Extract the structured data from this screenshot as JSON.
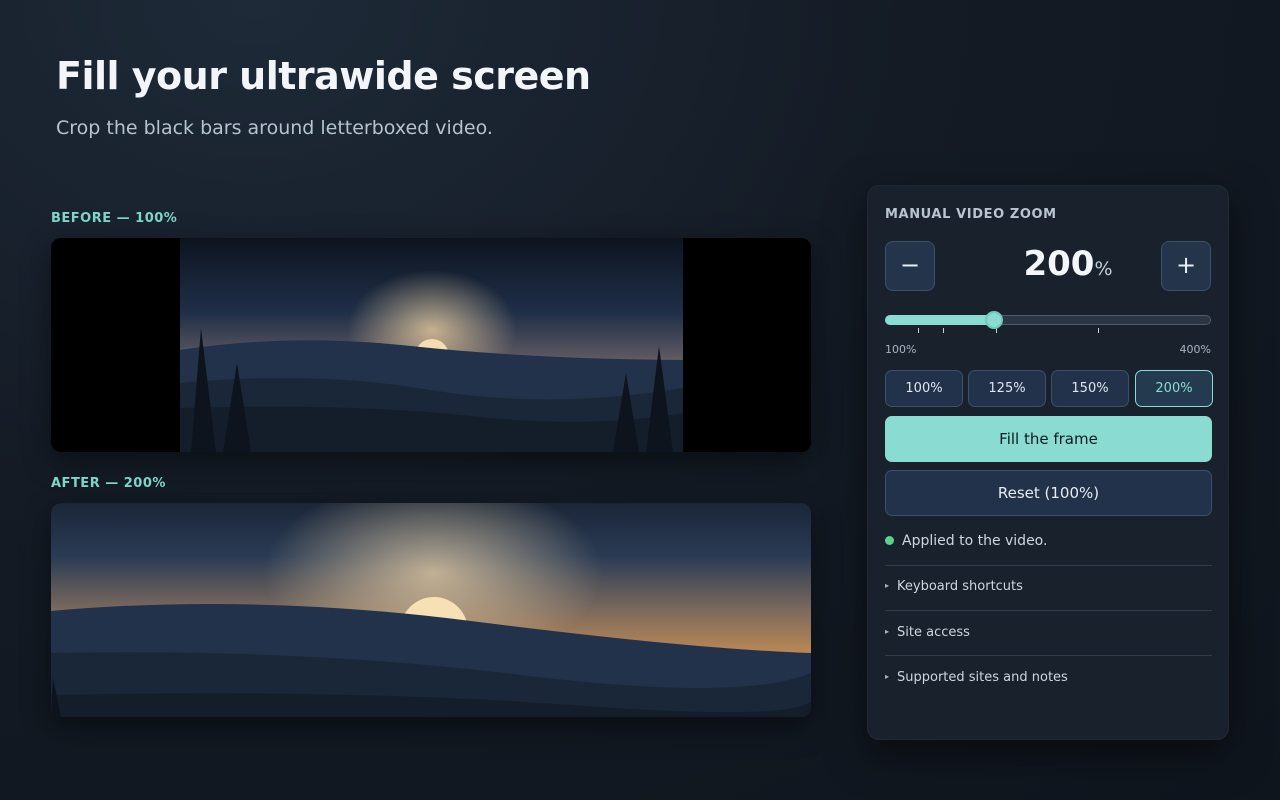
{
  "hero": {
    "title": "Fill your ultrawide screen",
    "subtitle": "Crop the black bars around letterboxed video."
  },
  "preview": {
    "before_label": "BEFORE — 100%",
    "after_label": "AFTER — 200%"
  },
  "panel": {
    "title": "MANUAL VIDEO ZOOM",
    "decrease_symbol": "−",
    "increase_symbol": "+",
    "zoom_value": "200",
    "zoom_unit": "%",
    "slider": {
      "min_label": "100%",
      "max_label": "400%",
      "min": 100,
      "max": 400,
      "value": 200
    },
    "presets": [
      "100%",
      "125%",
      "150%",
      "200%"
    ],
    "active_preset": "200%",
    "fill_button": "Fill the frame",
    "reset_button": "Reset (100%)",
    "status_text": "Applied to the video.",
    "status_color": "#5cd38a",
    "accent_color": "#8adbd1",
    "sections": [
      "Keyboard shortcuts",
      "Site access",
      "Supported sites and notes"
    ]
  }
}
